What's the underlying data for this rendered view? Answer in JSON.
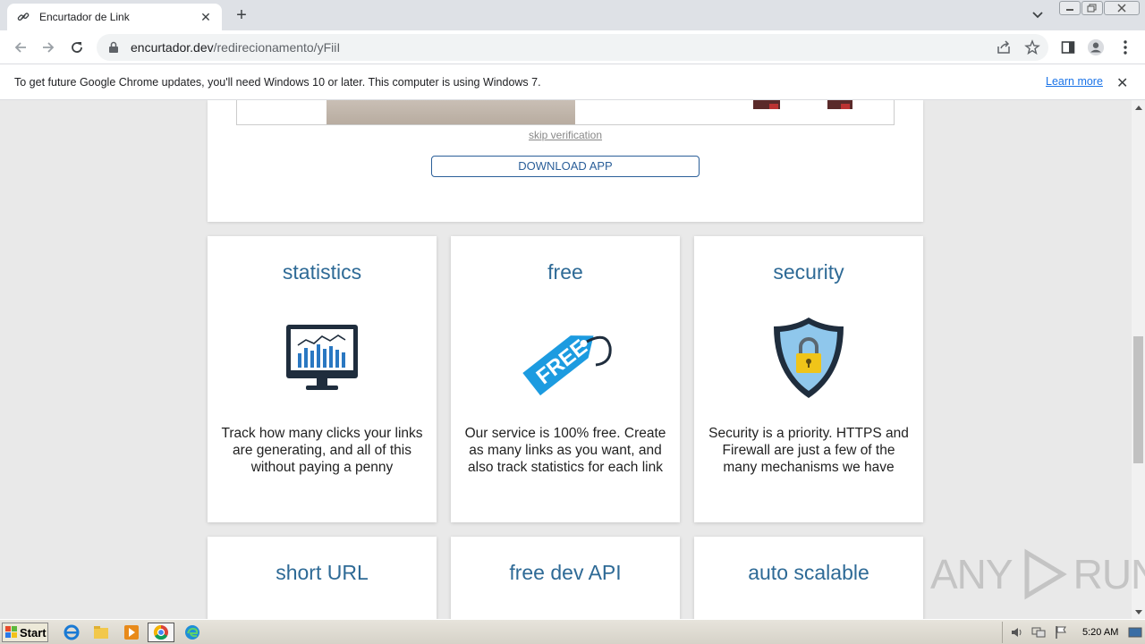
{
  "browser": {
    "tab_title": "Encurtador de Link",
    "tab_close": "✕",
    "new_tab": "+",
    "url_host": "encurtador.dev",
    "url_path": "/redirecionamento/yFiiI"
  },
  "infobar": {
    "message": "To get future Google Chrome updates, you'll need Windows 10 or later. This computer is using Windows 7.",
    "learn_more": "Learn more",
    "close": "✕"
  },
  "page": {
    "skip_verification": "skip verification",
    "download_app": "DOWNLOAD APP",
    "cards": [
      {
        "title": "statistics",
        "description": "Track how many clicks your links are generating, and all of this without paying a penny",
        "icon": "monitor-chart-icon"
      },
      {
        "title": "free",
        "description": "Our service is 100% free. Create as many links as you want, and also track statistics for each link",
        "icon": "free-tag-icon",
        "tag_text": "FREE"
      },
      {
        "title": "security",
        "description": "Security is a priority. HTTPS and Firewall are just a few of the many mechanisms we have",
        "icon": "shield-lock-icon"
      },
      {
        "title": "short URL"
      },
      {
        "title": "free dev API"
      },
      {
        "title": "auto scalable"
      }
    ]
  },
  "watermark": {
    "left": "ANY",
    "right": "RUN"
  },
  "taskbar": {
    "start_label": "Start",
    "clock": "5:20 AM"
  },
  "colors": {
    "accent_blue": "#2e6a96",
    "button_border": "#2b5f99",
    "link_blue": "#1a73e8"
  }
}
